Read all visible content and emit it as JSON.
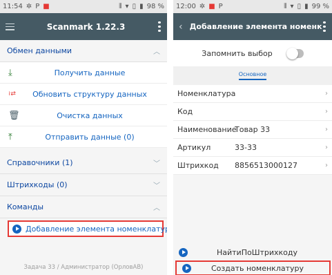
{
  "left": {
    "status": {
      "time": "11:54",
      "battery": "98 %"
    },
    "appbar": {
      "title": "Scanmark 1.22.3"
    },
    "sections": {
      "exchange": "Обмен данными",
      "directories": "Справочники (1)",
      "barcodes": "Штрихкоды (0)",
      "commands": "Команды"
    },
    "exchange_items": [
      {
        "icon": "download-icon",
        "label": "Получить данные"
      },
      {
        "icon": "sync-structure-icon",
        "label": "Обновить структуру данных"
      },
      {
        "icon": "trash-icon",
        "label": "Очистка данных"
      },
      {
        "icon": "upload-icon",
        "label": "Отправить данные (0)"
      }
    ],
    "command_label": "Добавление элемента номенклатуры",
    "footer": "Задача 33 / Администратор (ОрловАВ)"
  },
  "right": {
    "status": {
      "time": "12:00",
      "battery": "99 %"
    },
    "appbar": {
      "title": "Добавление элемента номенк..."
    },
    "remember_label": "Запомнить выбор",
    "remember_on": false,
    "tab_label": "Основное",
    "fields": [
      {
        "label": "Номенклатура",
        "value": ""
      },
      {
        "label": "Код",
        "value": ""
      },
      {
        "label": "Наименование",
        "value": "Товар 33"
      },
      {
        "label": "Артикул",
        "value": "33-33"
      },
      {
        "label": "Штрихкод",
        "value": "8856513000127"
      }
    ],
    "actions": {
      "find_by_barcode": "НайтиПоШтрихкоду",
      "create_item": "Создать номенклатуру"
    }
  },
  "colors": {
    "appbar": "#455a64",
    "link": "#1565c0",
    "highlight": "#e53935",
    "download": "#2e7d32"
  }
}
